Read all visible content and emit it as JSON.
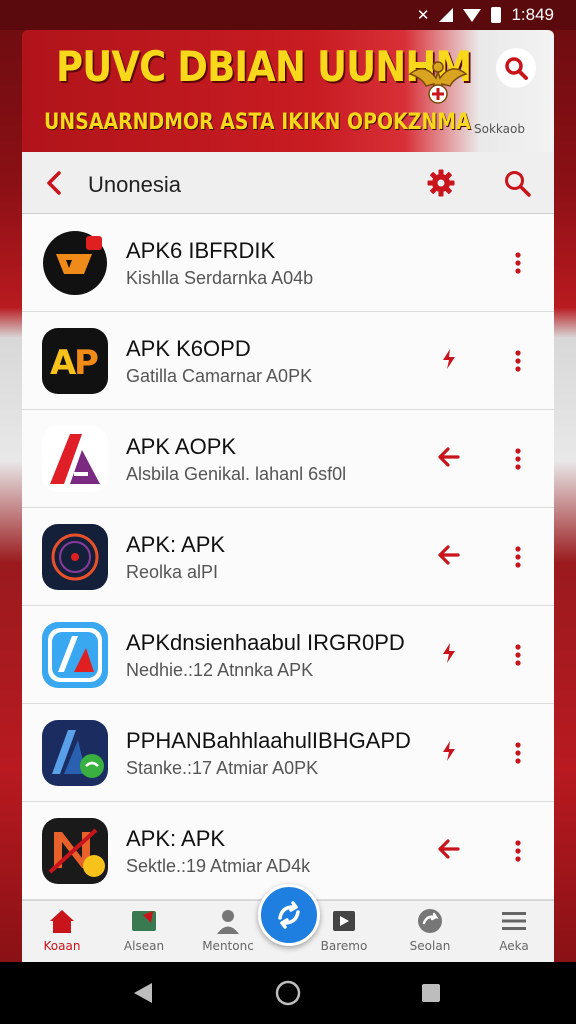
{
  "status_bar": {
    "time": "1:849",
    "icons": [
      "notification-icon",
      "signal-icon",
      "wifi-icon",
      "battery-icon"
    ]
  },
  "banner": {
    "title": "PUVC DBIAN UUNHM",
    "subtitle": "UNSAARNDMOR ASTA IKIKN OPOKZNMA",
    "caption": "Sokkaob",
    "title_color": "#f7d81a",
    "bg_color": "#c81c22"
  },
  "toolbar": {
    "title": "Unonesia",
    "accent": "#c8141a"
  },
  "apps": [
    {
      "name": "APK6 IBFRDIK",
      "desc": "Kishlla Serdarnka A04b",
      "icon": "apk-orange-icon",
      "action": "none"
    },
    {
      "name": "APK K6OPD",
      "desc": "Gatilla Camarnar A0PK",
      "icon": "ap-logo-icon",
      "action": "flash-icon"
    },
    {
      "name": "APK AOPK",
      "desc": "Alsbila Genikal. lahanl 6sf0l",
      "icon": "triangle-a-icon",
      "action": "arrow-left-icon"
    },
    {
      "name": "APK: APK",
      "desc": "Reolka alPI",
      "icon": "ring-target-icon",
      "action": "arrow-left-icon"
    },
    {
      "name": "APKdnsienhaabul IRGR0PD",
      "desc": "Nedhie.:12 Atnnka APK",
      "icon": "pen-a-icon",
      "action": "flash-icon"
    },
    {
      "name": "PPHANBahhlaahulIBHGAPD",
      "desc": "Stanke.:17 Atmiar A0PK",
      "icon": "chat-app-icon",
      "action": "flash-icon"
    },
    {
      "name": "APK: APK",
      "desc": "Sektle.:19 Atmiar AD4k",
      "icon": "n-logo-icon",
      "action": "arrow-left-icon"
    }
  ],
  "bottom_nav": {
    "items": [
      {
        "label": "Koaan",
        "icon": "home-icon",
        "active": true
      },
      {
        "label": "Alsean",
        "icon": "games-icon",
        "active": false
      },
      {
        "label": "Mentonc",
        "icon": "user-icon",
        "active": false
      },
      {
        "label": "Baremo",
        "icon": "video-icon",
        "active": false
      },
      {
        "label": "Seolan",
        "icon": "refresh-icon",
        "active": false
      },
      {
        "label": "Aeka",
        "icon": "menu-icon",
        "active": false
      }
    ],
    "fab_icon": "flash-share-icon"
  }
}
